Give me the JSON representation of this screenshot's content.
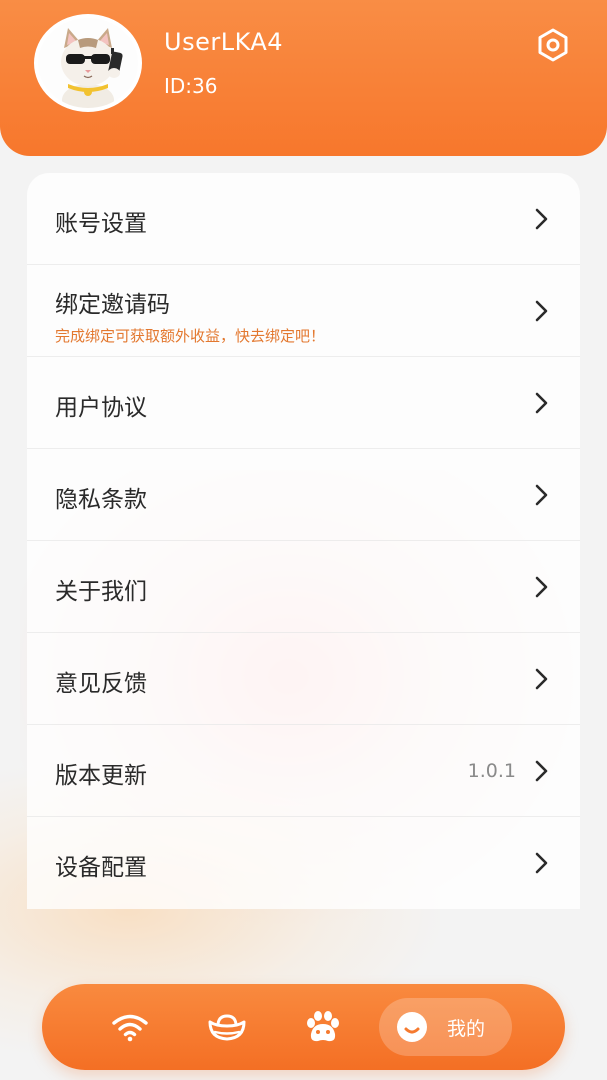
{
  "profile": {
    "username": "UserLKA4",
    "user_id": "ID:36",
    "avatar_icon": "cat-with-sunglasses-avatar",
    "settings_icon": "settings-hexagon-icon"
  },
  "menu": {
    "items": [
      {
        "label": "账号设置"
      },
      {
        "label": "绑定邀请码",
        "sub": "完成绑定可获取额外收益，快去绑定吧！"
      },
      {
        "label": "用户协议"
      },
      {
        "label": "隐私条款"
      },
      {
        "label": "关于我们"
      },
      {
        "label": "意见反馈"
      },
      {
        "label": "版本更新",
        "value": "1.0.1"
      },
      {
        "label": "设备配置"
      }
    ]
  },
  "bottom_nav": {
    "items": [
      {
        "icon": "wifi-icon"
      },
      {
        "icon": "gold-ingot-icon"
      },
      {
        "icon": "paw-icon"
      },
      {
        "icon": "smile-icon",
        "label": "我的",
        "active": true
      }
    ]
  },
  "colors": {
    "brand_orange": "#f7772c",
    "sub_text_orange": "#e3782f",
    "text_dark": "#2a2a2a",
    "text_gray": "#8a8a8a"
  }
}
